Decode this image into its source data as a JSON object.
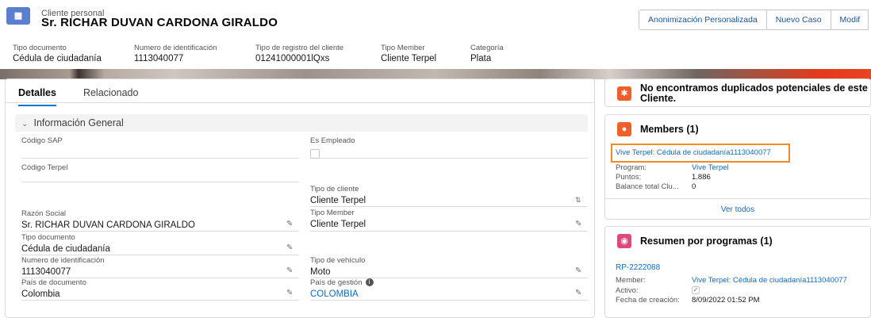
{
  "header": {
    "object_label": "Cliente personal",
    "title": "Sr. RICHAR DUVAN CARDONA GIRALDO",
    "actions": [
      "Anonimización Personalizada",
      "Nuevo Caso",
      "Modif"
    ],
    "highlights": [
      {
        "label": "Tipo documento",
        "value": "Cédula de ciudadanía"
      },
      {
        "label": "Numero de identificación",
        "value": "1113040077"
      },
      {
        "label": "Tipo de registro del cliente",
        "value": "01241000001lQxs"
      },
      {
        "label": "Tipo Member",
        "value": "Cliente Terpel"
      },
      {
        "label": "Categoría",
        "value": "Plata"
      }
    ]
  },
  "tabs": [
    "Detalles",
    "Relacionado"
  ],
  "section": {
    "title": "Información General"
  },
  "fields": {
    "codigo_sap": {
      "label": "Código SAP",
      "value": ""
    },
    "es_empleado": {
      "label": "Es Empleado",
      "checked": false
    },
    "codigo_terpel": {
      "label": "Código Terpel",
      "value": ""
    },
    "tipo_cliente": {
      "label": "Tipo de cliente",
      "value": "Cliente Terpel"
    },
    "razon_social": {
      "label": "Razón Social",
      "value": "Sr. RICHAR DUVAN CARDONA GIRALDO"
    },
    "tipo_member": {
      "label": "Tipo Member",
      "value": "Cliente Terpel"
    },
    "tipo_documento": {
      "label": "Tipo documento",
      "value": "Cédula de ciudadanía"
    },
    "numero_identificacion": {
      "label": "Numero de identificación",
      "value": "1113040077"
    },
    "tipo_vehiculo": {
      "label": "Tipo de vehículo",
      "value": "Moto"
    },
    "pais_documento": {
      "label": "País de documento",
      "value": "Colombia"
    },
    "pais_gestion": {
      "label": "País de gestión",
      "value": "COLOMBIA"
    }
  },
  "duplicates": {
    "message": "No encontramos duplicados potenciales de este Cliente."
  },
  "members": {
    "title": "Members (1)",
    "record_link": "Vive Terpel: Cédula de ciudadanía1113040077",
    "rows": [
      {
        "key": "Program:",
        "value": "Vive Terpel"
      },
      {
        "key": "Puntos:",
        "value": "1.886"
      },
      {
        "key": "Balance total Clu...",
        "value": "0"
      }
    ],
    "view_all": "Ver todos"
  },
  "programas": {
    "title": "Resumen por programas (1)",
    "record_link": "RP-2222088",
    "rows": [
      {
        "key": "Member:",
        "value": "Vive Terpel: Cédula de ciudadanía1113040077"
      },
      {
        "key": "Activo:",
        "value": ""
      },
      {
        "key": "Fecha de creación:",
        "value": "8/09/2022 01:52 PM"
      }
    ]
  },
  "colors": {
    "accent": "#0176d3",
    "link": "#0b6bcb",
    "highlight_box": "#f08a24",
    "duplicates_icon": "#f05f2a",
    "members_icon": "#f05f2a",
    "programas_icon": "#e0477c"
  }
}
